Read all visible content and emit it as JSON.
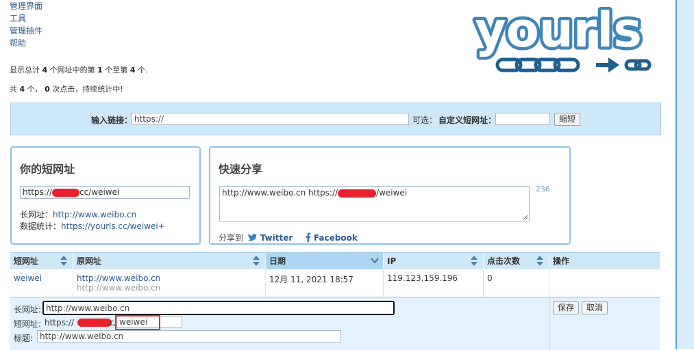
{
  "nav": {
    "items": [
      "管理界面",
      "工具",
      "管理插件",
      "帮助"
    ]
  },
  "info": {
    "line1_prefix": "显示总计",
    "line1_total": "4",
    "line1_mid": "个网址中的第",
    "line1_from": "1",
    "line1_to_label": "个至第",
    "line1_to": "4",
    "line1_suffix": "个.",
    "line2_prefix": "共",
    "line2_count": "4",
    "line2_mid": "个，",
    "line2_clicks": "0",
    "line2_suffix": "次点击，持续统计中!"
  },
  "logo": {
    "text": "yourls"
  },
  "new_url": {
    "label": "输入链接：",
    "value": "https://",
    "optional_label": "可选：",
    "custom_label": "自定义短网址：",
    "custom_value": "",
    "button": "缩短"
  },
  "your_short": {
    "title": "你的短网址",
    "url_prefix": "https://",
    "url_suffix": "cc/weiwei",
    "long_label": "长网址：",
    "long_url": "http://www.weibo.cn",
    "stats_label": "数据统计：",
    "stats_url": "https://yourls.cc/weiwei+"
  },
  "quick_share": {
    "title": "快速分享",
    "text_prefix": "http://www.weibo.cn https://",
    "text_suffix": "/weiwei",
    "char_count": "236",
    "share_to": "分享到",
    "twitter": "Twitter",
    "facebook": "Facebook"
  },
  "table": {
    "headers": [
      "短网址",
      "原网址",
      "日期",
      "IP",
      "点击次数",
      "操作"
    ],
    "row": {
      "keyword": "weiwei",
      "url": "http://www.weibo.cn",
      "title": "http://www.weibo.cn",
      "date": "12月 11, 2021 18:57",
      "ip": "119.123.159.196",
      "clicks": "0"
    }
  },
  "edit": {
    "long_label": "长网址:",
    "long_value": "http://www.weibo.cn",
    "short_label": "短网址:",
    "short_prefix": "https://",
    "short_mid": "c/",
    "short_value": "weiwei",
    "title_label": "标题:",
    "title_value": "http://www.weibo.cn",
    "save": "保存",
    "cancel": "取消"
  },
  "colors": {
    "accent": "#2a5a8a",
    "panel": "#cfe8f8",
    "logo": "#1f6a9a",
    "redact": "#e8232d",
    "highlight": "#d9333a"
  }
}
